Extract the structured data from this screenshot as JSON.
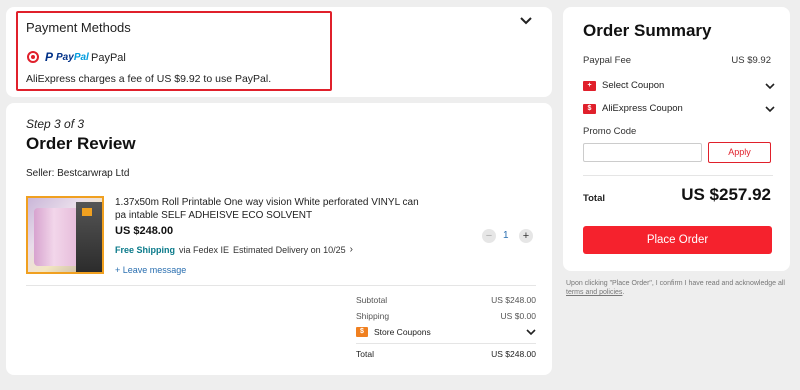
{
  "payment": {
    "title": "Payment Methods",
    "method_logo_p": "P",
    "method_logo_word_a": "Pay",
    "method_logo_word_b": "Pal",
    "method_label": "PayPal",
    "fee_note": "AliExpress charges a fee of US $9.92 to use PayPal.",
    "highlight_color": "#e0202b"
  },
  "review": {
    "step": "Step 3 of 3",
    "title": "Order Review",
    "seller": "Seller: Bestcarwrap Ltd",
    "product": {
      "name": "1.37x50m Roll Printable One way vision White perforated VINYL can pa intable SELF ADHEISVE ECO SOLVENT",
      "price": "US $248.00",
      "free_shipping": "Free Shipping",
      "carrier": "via Fedex IE",
      "delivery": "Estimated Delivery on 10/25",
      "leave_message": "+ Leave message",
      "quantity": "1"
    },
    "summary": {
      "subtotal_label": "Subtotal",
      "subtotal_value": "US $248.00",
      "shipping_label": "Shipping",
      "shipping_value": "US $0.00",
      "coupons_label": "Store Coupons",
      "total_label": "Total",
      "total_value": "US $248.00"
    }
  },
  "order_summary": {
    "title": "Order Summary",
    "fee_label": "Paypal Fee",
    "fee_value": "US $9.92",
    "select_coupon": "Select Coupon",
    "ae_coupon": "AliExpress Coupon",
    "promo_label": "Promo Code",
    "promo_value": "",
    "apply": "Apply",
    "total_label": "Total",
    "total_value": "US $257.92",
    "place_order": "Place Order",
    "accent_color": "#f5222d"
  },
  "disclaimer": {
    "text": "Upon clicking \"Place Order\", I confirm I have read and acknowledge all",
    "link": "terms and policies",
    "suffix": "."
  }
}
